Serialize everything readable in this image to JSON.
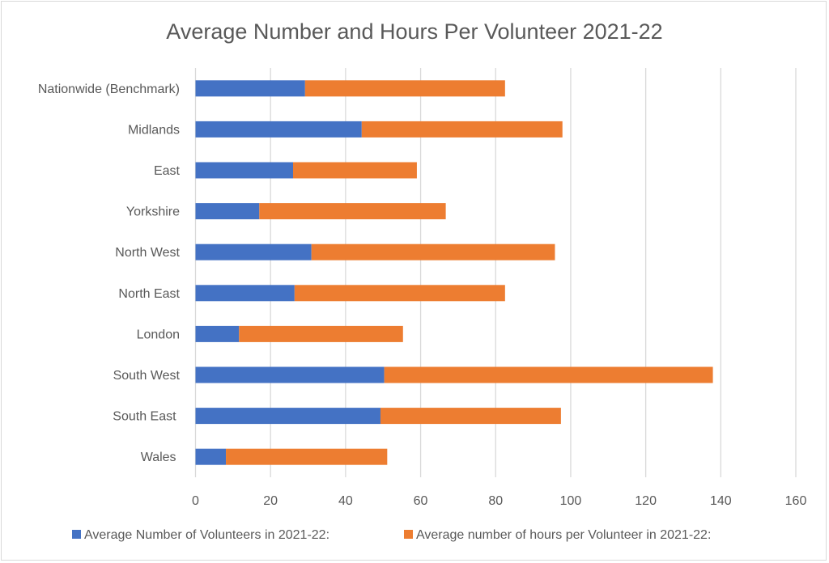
{
  "chart_data": {
    "type": "bar",
    "orientation": "horizontal",
    "stacked": true,
    "title": "Average Number and Hours Per Volunteer 2021-22",
    "xlabel": "",
    "ylabel": "",
    "xlim": [
      0,
      160
    ],
    "xticks": [
      0,
      20,
      40,
      60,
      80,
      100,
      120,
      140,
      160
    ],
    "grid": true,
    "legend_position": "bottom",
    "categories": [
      "Nationwide (Benchmark)",
      "Midlands",
      "East",
      "Yorkshire",
      "North West",
      "North East",
      "London",
      "South West",
      "South East ",
      "Wales "
    ],
    "series": [
      {
        "name": "Average Number of Volunteers in 2021-22:",
        "color": "#4472c4",
        "values": [
          29.2,
          44.3,
          26.0,
          17.0,
          30.9,
          26.4,
          11.6,
          50.3,
          49.3,
          8.1
        ]
      },
      {
        "name": "Average number of hours per Volunteer in 2021-22:",
        "color": "#ed7d31",
        "values": [
          53.3,
          53.5,
          33.0,
          49.7,
          64.9,
          56.1,
          43.7,
          87.6,
          48.1,
          43.0
        ]
      }
    ]
  }
}
